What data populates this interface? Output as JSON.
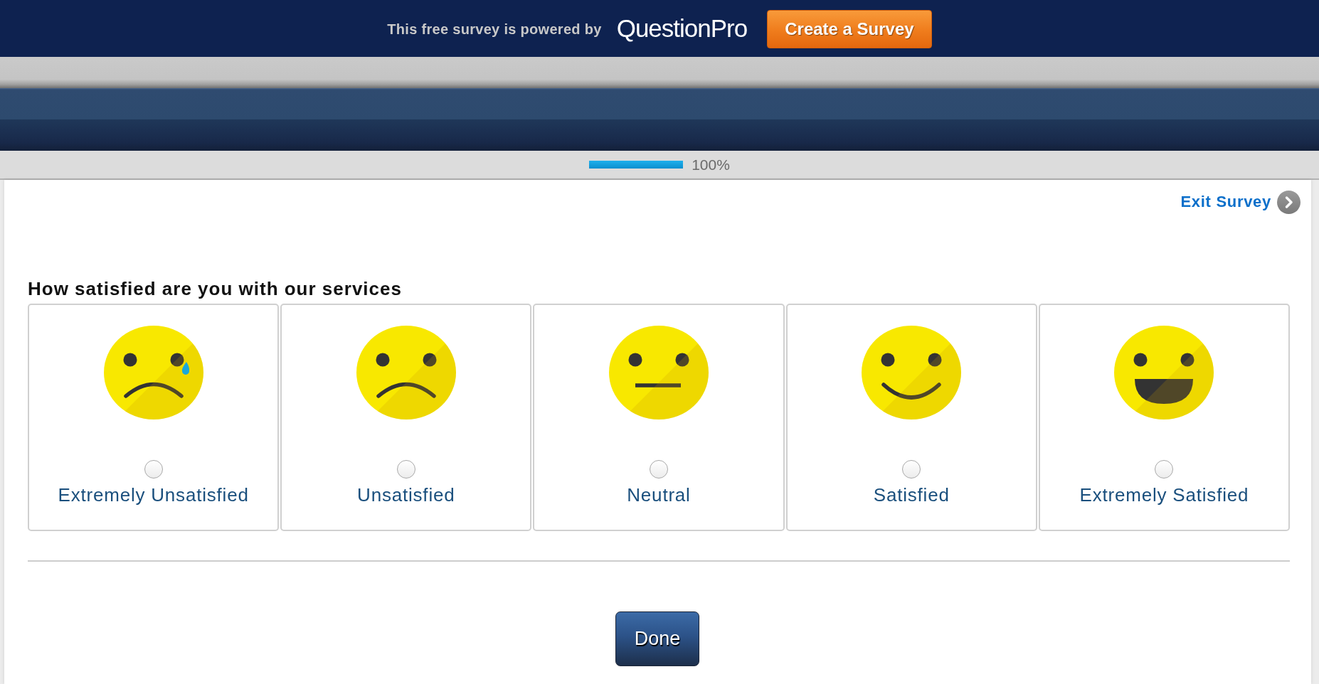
{
  "banner": {
    "text": "This free survey is powered by",
    "logo": "QuestionPro",
    "button": "Create a Survey"
  },
  "progress": {
    "level": 1,
    "reading": "100%"
  },
  "exit_link": "Exit Survey",
  "question": {
    "title": "How satisfied are you with our services",
    "options": [
      {
        "kind": "crying",
        "label": "Extremely Unsatisfied",
        "selected": false
      },
      {
        "kind": "sad",
        "label": "Unsatisfied",
        "selected": false
      },
      {
        "kind": "neutral",
        "label": "Neutral",
        "selected": false
      },
      {
        "kind": "smile",
        "label": "Satisfied",
        "selected": false
      },
      {
        "kind": "grin",
        "label": "Extremely Satisfied",
        "selected": false
      }
    ]
  },
  "buttons": [
    "Done"
  ]
}
